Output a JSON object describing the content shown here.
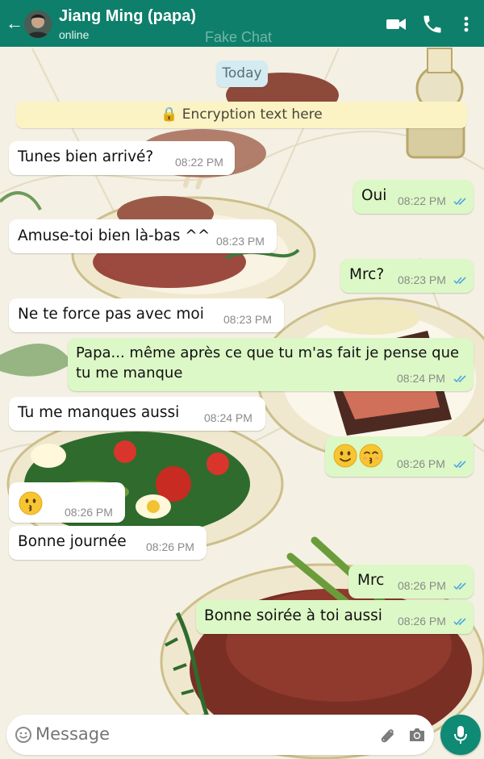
{
  "header": {
    "contact_name": "Jiang Ming (papa)",
    "status": "online",
    "watermark": "Fake Chat",
    "icons": [
      "back-arrow-icon",
      "video-call-icon",
      "voice-call-icon",
      "more-options-icon"
    ]
  },
  "chat": {
    "date_chip": "Today",
    "encryption_notice": "🔒 Encryption text here",
    "messages": [
      {
        "dir": "in",
        "text": "Tunes bien arrivé?",
        "time": "08:22 PM"
      },
      {
        "dir": "out",
        "text": "Oui",
        "time": "08:22 PM"
      },
      {
        "dir": "in",
        "text": "Amuse-toi bien là-bas ^^",
        "time": "08:23 PM"
      },
      {
        "dir": "out",
        "text": "Mrc?",
        "time": "08:23 PM"
      },
      {
        "dir": "in",
        "text": "Ne te force pas avec moi",
        "time": "08:23 PM"
      },
      {
        "dir": "out",
        "text": "Papa... même après ce que tu m'as fait je pense que",
        "text2": "tu me manque",
        "time": "08:24 PM"
      },
      {
        "dir": "in",
        "text": "Tu me manques aussi",
        "time": "08:24 PM"
      },
      {
        "dir": "out",
        "emoji": [
          "slightly-smiling-face",
          "kissing-face-with-smiling-eyes"
        ],
        "time": "08:26 PM"
      },
      {
        "dir": "in",
        "emoji": [
          "kissing-face"
        ],
        "time": "08:26 PM"
      },
      {
        "dir": "in",
        "text": "Bonne journée",
        "time": "08:26 PM"
      },
      {
        "dir": "out",
        "text": "Mrc",
        "time": "08:26 PM"
      },
      {
        "dir": "out",
        "text": "Bonne soirée à toi aussi",
        "time": "08:26 PM"
      }
    ]
  },
  "composer": {
    "placeholder": "Message",
    "icons": [
      "emoji-icon",
      "attach-icon",
      "camera-icon",
      "microphone-icon"
    ]
  },
  "colors": {
    "header": "#0e7f6b",
    "outgoing_bubble": "#dcf8c6",
    "incoming_bubble": "#ffffff",
    "read_ticks": "#4fa7e0",
    "mic_button": "#0f8a74"
  }
}
